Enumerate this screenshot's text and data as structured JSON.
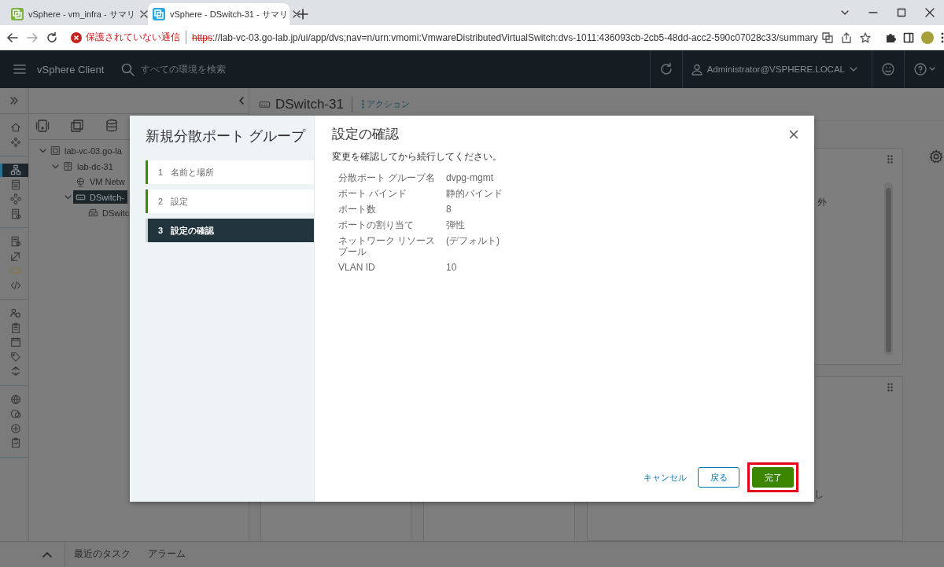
{
  "browser": {
    "tabs": [
      {
        "title": "vSphere - vm_infra - サマリ",
        "selected": false,
        "color": "#7cb342"
      },
      {
        "title": "vSphere - DSwitch-31 - サマリ",
        "selected": true,
        "color": "#29a8e0"
      }
    ],
    "address": {
      "security": "保護されていない通信",
      "scheme": "https",
      "rest": "://lab-vc-03.go-lab.jp/ui/app/dvs;nav=n/urn:vmomi:VmwareDistributedVirtualSwitch:dvs-1011:436093cb-2cb5-48dd-acc2-590c07028c33/summary"
    }
  },
  "header": {
    "product": "vSphere Client",
    "search": {
      "placeholder": "すべての環境を検索"
    },
    "user": "Administrator@VSPHERE.LOCAL"
  },
  "sidebar": {
    "groups": [
      {
        "items": [
          {
            "selected": false
          },
          {
            "selected": false
          }
        ]
      },
      {
        "items": [
          {
            "selected": true
          },
          {
            "selected": false
          },
          {
            "selected": false
          },
          {
            "selected": false
          }
        ]
      },
      {
        "items": [
          {
            "selected": false
          },
          {
            "selected": false
          },
          {
            "selected": false
          },
          {
            "selected": false
          }
        ]
      },
      {
        "items": [
          {
            "selected": false
          },
          {
            "selected": false
          },
          {
            "selected": false
          },
          {
            "selected": false
          },
          {
            "selected": false
          }
        ]
      },
      {
        "items": [
          {
            "selected": false
          },
          {
            "selected": false
          },
          {
            "selected": false
          },
          {
            "selected": false
          }
        ]
      }
    ]
  },
  "tree": [
    {
      "label": "lab-vc-03.go-la",
      "kind": "vcenter",
      "expanded": true,
      "selected": false,
      "children": [
        {
          "label": "lab-dc-31",
          "kind": "datacenter",
          "expanded": true,
          "selected": false,
          "children": [
            {
              "label": "VM Netw",
              "kind": "network",
              "selected": false
            },
            {
              "label": "DSwitch-",
              "kind": "switch",
              "expanded": true,
              "selected": true,
              "children": [
                {
                  "label": "DSwitc",
                  "kind": "portgroup",
                  "selected": false
                }
              ]
            }
          ]
        }
      ]
    }
  ],
  "object": {
    "title": "DSwitch-31",
    "actions": "アクション"
  },
  "card_fragments": [
    "外",
    "し"
  ],
  "bottom_bar": {
    "tabs": [
      {
        "label": "最近のタスク",
        "selected": false
      },
      {
        "label": "アラーム",
        "selected": false
      }
    ]
  },
  "dialog": {
    "title": "新規分散ポート グループ",
    "steps": [
      {
        "number": "1",
        "label": "名前と場所",
        "selected": false,
        "completed": true
      },
      {
        "number": "2",
        "label": "設定",
        "selected": false,
        "completed": true
      },
      {
        "number": "3",
        "label": "設定の確認",
        "selected": true,
        "completed": false
      }
    ],
    "page": {
      "title": "設定の確認",
      "instructions": "変更を確認してから続行してください。",
      "rows": [
        {
          "label": "分散ポート グループ名",
          "value": "dvpg-mgmt"
        },
        {
          "label": "ポート バインド",
          "value": "静的バインド"
        },
        {
          "label": "ポート数",
          "value": "8"
        },
        {
          "label": "ポートの割り当て",
          "value": "弾性"
        },
        {
          "label": "ネットワーク リソースプール",
          "value": "(デフォルト)"
        },
        {
          "label": "VLAN ID",
          "value": "10"
        }
      ]
    },
    "buttons": [
      {
        "label": "キャンセル",
        "kind": "link",
        "highlighted": false
      },
      {
        "label": "戻る",
        "kind": "outline",
        "highlighted": false
      },
      {
        "label": "完了",
        "kind": "primary",
        "highlighted": true
      }
    ]
  }
}
